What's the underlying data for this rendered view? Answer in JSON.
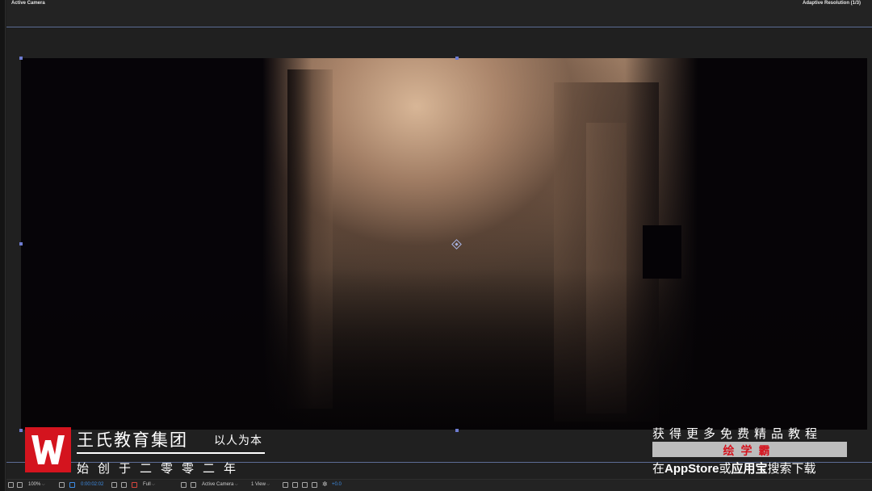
{
  "viewer": {
    "title": "Active Camera",
    "resolution_status": "Adaptive Resolution (1/3)"
  },
  "toolbar": {
    "zoom": "100%",
    "timecode": "0:00:02:02",
    "resolution": "Full",
    "camera": "Active Camera",
    "views": "1 View",
    "exposure": "+0.0"
  },
  "watermark": {
    "brand_name": "王氏教育集团",
    "brand_motto": "以人为本",
    "brand_since": "始创于二零零二年",
    "logo_letter": "W",
    "promo_top": "获得更多免费精品教程",
    "promo_app": "绘学霸",
    "promo_bottom_pre": "在",
    "promo_bottom_store": "AppStore",
    "promo_bottom_or": "或",
    "promo_bottom_market": "应用宝",
    "promo_bottom_post": "搜索下载"
  },
  "colors": {
    "accent": "#5c6d95",
    "handle": "#6d7bd0",
    "logo_red": "#d4141e",
    "timecode_blue": "#3e8de6"
  }
}
